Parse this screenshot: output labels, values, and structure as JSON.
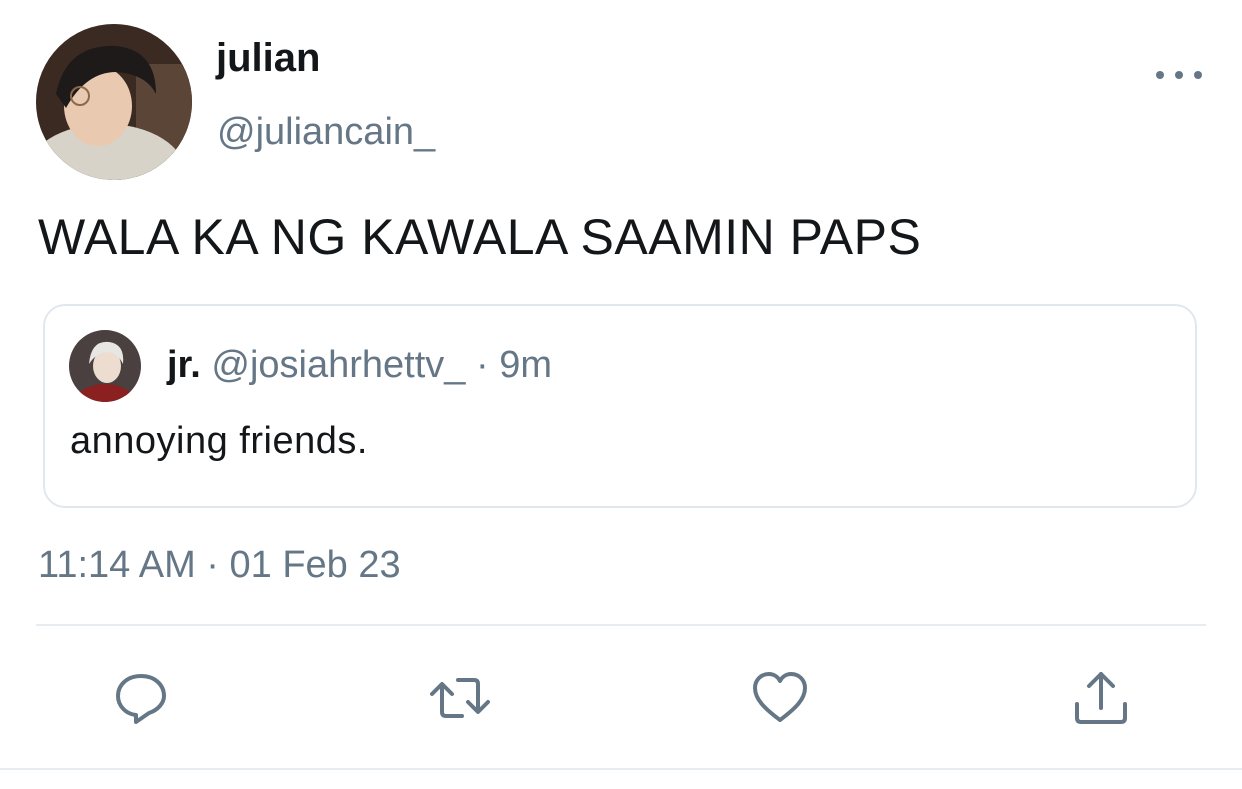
{
  "tweet": {
    "author": {
      "display_name": "julian",
      "handle": "@juliancain_"
    },
    "text": "WALA KA NG KAWALA SAAMIN PAPS",
    "timestamp": "11:14 AM",
    "date": "01 Feb 23",
    "separator": "·"
  },
  "quoted_tweet": {
    "display_name": "jr.",
    "handle": "@josiahrhettv_",
    "separator": "·",
    "age": "9m",
    "text": "annoying friends."
  },
  "actions": [
    {
      "icon": "reply-icon"
    },
    {
      "icon": "retweet-icon"
    },
    {
      "icon": "like-icon"
    },
    {
      "icon": "share-icon"
    }
  ],
  "colors": {
    "text_primary": "#14171a",
    "text_secondary": "#657786",
    "border": "#e1e8ed",
    "icon": "#657786"
  }
}
